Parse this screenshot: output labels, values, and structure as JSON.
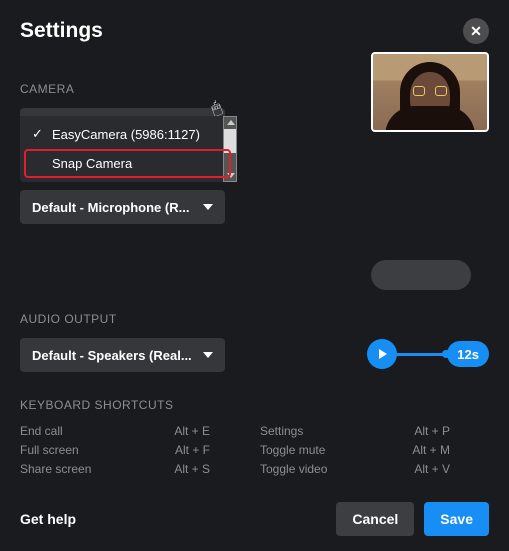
{
  "title": "Settings",
  "camera": {
    "label": "CAMERA",
    "selected": "EasyCamera (5986:1127)",
    "options": [
      {
        "label": "EasyCamera (5986:1127)",
        "selected": true,
        "highlight": false
      },
      {
        "label": "Snap Camera",
        "selected": false,
        "highlight": true
      }
    ]
  },
  "microphone": {
    "selected": "Default - Microphone (R..."
  },
  "audio_output": {
    "label": "AUDIO OUTPUT",
    "selected": "Default - Speakers (Real...",
    "duration": "12s"
  },
  "keyboard": {
    "label": "KEYBOARD SHORTCUTS",
    "left": [
      {
        "name": "End call",
        "key": "Alt + E"
      },
      {
        "name": "Full screen",
        "key": "Alt + F"
      },
      {
        "name": "Share screen",
        "key": "Alt + S"
      }
    ],
    "right": [
      {
        "name": "Settings",
        "key": "Alt + P"
      },
      {
        "name": "Toggle mute",
        "key": "Alt + M"
      },
      {
        "name": "Toggle video",
        "key": "Alt + V"
      }
    ]
  },
  "footer": {
    "help": "Get help",
    "cancel": "Cancel",
    "save": "Save"
  },
  "icons": {
    "close": "✕"
  }
}
